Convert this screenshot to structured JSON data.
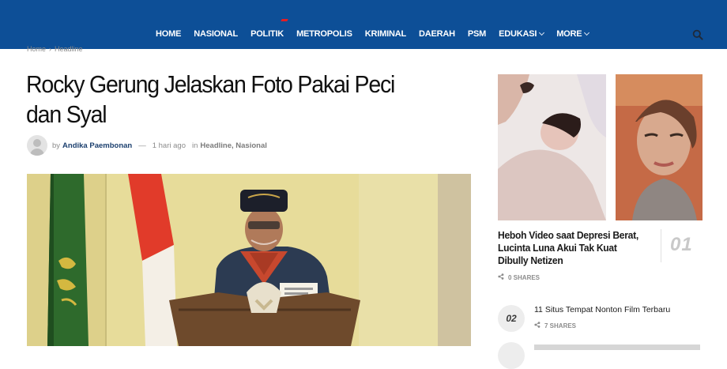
{
  "nav": {
    "items": [
      {
        "label": "HOME",
        "has_dropdown": false
      },
      {
        "label": "NASIONAL",
        "has_dropdown": false
      },
      {
        "label": "POLITIK",
        "has_dropdown": false,
        "hot_marker": true
      },
      {
        "label": "METROPOLIS",
        "has_dropdown": false
      },
      {
        "label": "KRIMINAL",
        "has_dropdown": false
      },
      {
        "label": "DAERAH",
        "has_dropdown": false
      },
      {
        "label": "PSM",
        "has_dropdown": false
      },
      {
        "label": "EDUKASI",
        "has_dropdown": true
      },
      {
        "label": "MORE",
        "has_dropdown": true
      }
    ],
    "search_icon": "search-icon",
    "background": "#0d4f97",
    "hot_color": "#e31e24"
  },
  "breadcrumb": {
    "home": "Home",
    "separator": "›",
    "current": "Headline"
  },
  "article": {
    "title": "Rocky Gerung Jelaskan Foto Pakai Peci dan Syal",
    "by": "by",
    "author": "Andika Paembonan",
    "dash": "—",
    "time": "1 hari ago",
    "in": "in",
    "categories": "Headline, Nasional"
  },
  "sidebar": {
    "top": {
      "title": "Heboh Video saat Depresi Berat, Lucinta Luna Akui Tak Kuat Dibully Netizen",
      "rank": "01",
      "shares": "0 SHARES"
    },
    "second": {
      "rank": "02",
      "title": "11 Situs Tempat Nonton Film Terbaru",
      "shares": "7 SHARES"
    }
  }
}
